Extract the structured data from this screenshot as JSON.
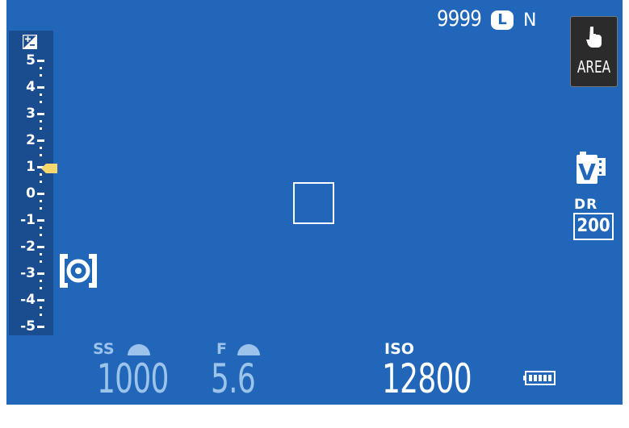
{
  "status": {
    "shots_remaining": "9999",
    "image_size": "L",
    "image_quality": "N"
  },
  "area_button": {
    "label": "AREA",
    "icon": "touch-hand-icon"
  },
  "exposure_comp": {
    "icon": "exposure-compensation-icon",
    "ticks": [
      "5",
      "4",
      "3",
      "2",
      "1",
      "0",
      "-1",
      "-2",
      "-3",
      "-4",
      "-5"
    ],
    "current_value": 1,
    "pointer_color": "#f5d76e"
  },
  "metering": {
    "icon": "multi-metering-icon"
  },
  "film_simulation": {
    "icon": "film-simulation-velvia-icon",
    "letter": "V"
  },
  "dynamic_range": {
    "label": "DR",
    "value": "200"
  },
  "shutter_speed": {
    "label": "SS",
    "value": "1000"
  },
  "aperture": {
    "label": "F",
    "value": "5.6"
  },
  "iso": {
    "label": "ISO",
    "value": "12800"
  },
  "battery": {
    "icon": "battery-icon",
    "level": 1.0
  },
  "colors": {
    "background": "#2166b8",
    "inactive_text": "#9cc3ea",
    "active_text": "#ffffff"
  }
}
